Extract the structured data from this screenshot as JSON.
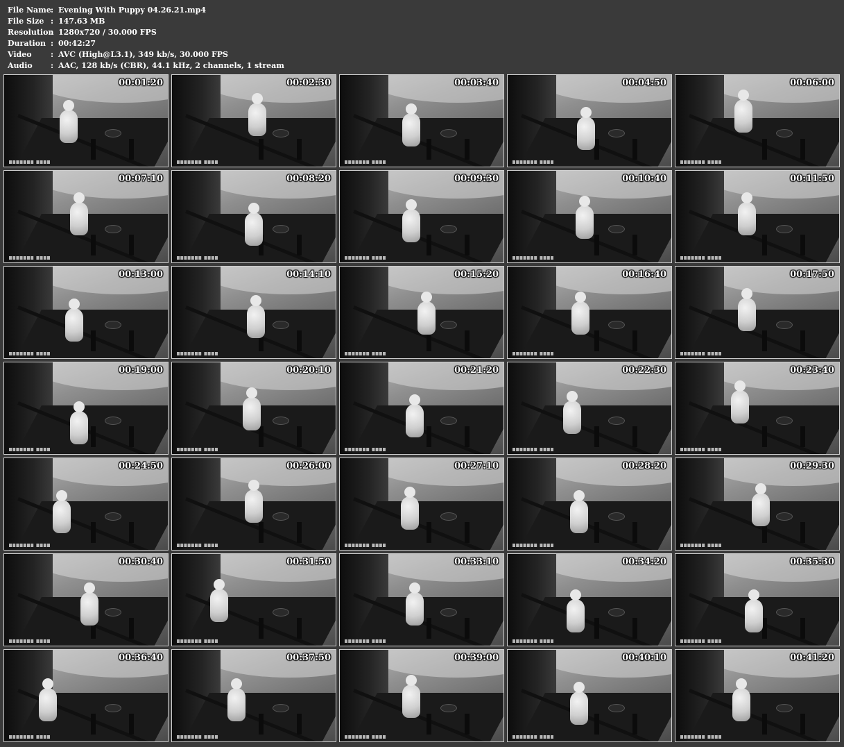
{
  "info": [
    {
      "label": "File Name",
      "sep": ":",
      "value": "Evening With Puppy 04.26.21.mp4"
    },
    {
      "label": "File Size",
      "sep": ":",
      "value": "147.63 MB"
    },
    {
      "label": "Resolution",
      "sep": ":",
      "value": "1280x720 / 30.000 FPS"
    },
    {
      "label": "Duration",
      "sep": ":",
      "value": "00:42:27"
    },
    {
      "label": "Video",
      "sep": ":",
      "value": "AVC (High@L3.1), 349 kb/s, 30.000 FPS"
    },
    {
      "label": "Audio",
      "sep": ":",
      "value": "AAC, 128 kb/s (CBR), 44.1 kHz, 2 channels, 1 stream"
    }
  ],
  "thumbnails": [
    {
      "timestamp": "00:01:20"
    },
    {
      "timestamp": "00:02:30"
    },
    {
      "timestamp": "00:03:40"
    },
    {
      "timestamp": "00:04:50"
    },
    {
      "timestamp": "00:06:00"
    },
    {
      "timestamp": "00:07:10"
    },
    {
      "timestamp": "00:08:20"
    },
    {
      "timestamp": "00:09:30"
    },
    {
      "timestamp": "00:10:40"
    },
    {
      "timestamp": "00:11:50"
    },
    {
      "timestamp": "00:13:00"
    },
    {
      "timestamp": "00:14:10"
    },
    {
      "timestamp": "00:15:20"
    },
    {
      "timestamp": "00:16:40"
    },
    {
      "timestamp": "00:17:50"
    },
    {
      "timestamp": "00:19:00"
    },
    {
      "timestamp": "00:20:10"
    },
    {
      "timestamp": "00:21:20"
    },
    {
      "timestamp": "00:22:30"
    },
    {
      "timestamp": "00:23:40"
    },
    {
      "timestamp": "00:24:50"
    },
    {
      "timestamp": "00:26:00"
    },
    {
      "timestamp": "00:27:10"
    },
    {
      "timestamp": "00:28:20"
    },
    {
      "timestamp": "00:29:30"
    },
    {
      "timestamp": "00:30:40"
    },
    {
      "timestamp": "00:31:50"
    },
    {
      "timestamp": "00:33:10"
    },
    {
      "timestamp": "00:34:20"
    },
    {
      "timestamp": "00:35:30"
    },
    {
      "timestamp": "00:36:40"
    },
    {
      "timestamp": "00:37:50"
    },
    {
      "timestamp": "00:39:00"
    },
    {
      "timestamp": "00:40:10"
    },
    {
      "timestamp": "00:41:20"
    }
  ],
  "watermark": {
    "icon": "bondage-life-watermark-logo"
  },
  "colors": {
    "background": "#3a3a3a",
    "text": "#ffffff",
    "thumb_border": "#cfcfcf"
  }
}
